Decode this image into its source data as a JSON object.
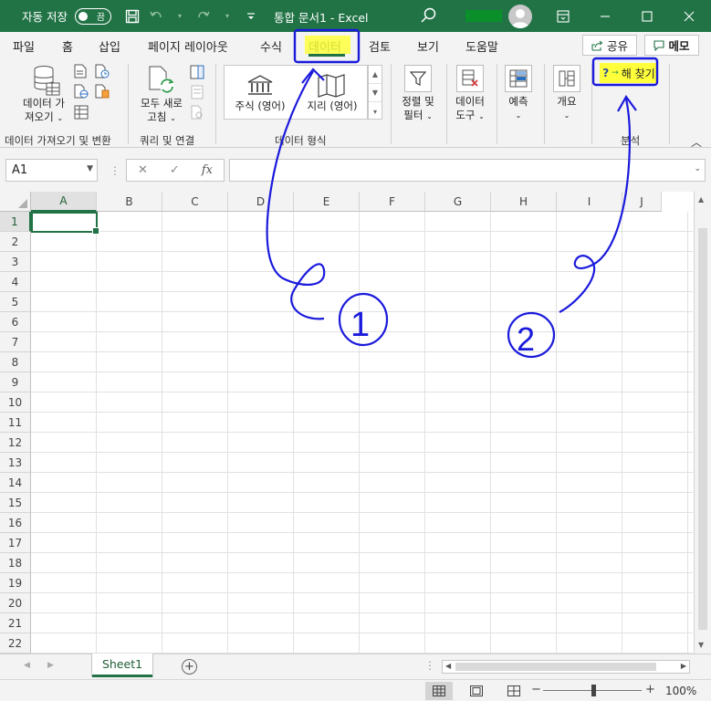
{
  "titlebar": {
    "autosave_label": "자동 저장",
    "autosave_state": "끔",
    "document_title": "통합 문서1  -  Excel"
  },
  "tabs": {
    "file": "파일",
    "home": "홈",
    "insert": "삽입",
    "page_layout": "페이지 레이아웃",
    "formulas": "수식",
    "data": "데이터",
    "review": "검토",
    "view": "보기",
    "help": "도움말"
  },
  "actions": {
    "share": "공유",
    "memo": "메모"
  },
  "ribbon": {
    "get_data_line1": "데이터 가",
    "get_data_line2": "져오기",
    "refresh_line1": "모두 새로",
    "refresh_line2": "고침",
    "stocks": "주식 (영어)",
    "geography": "지리 (영어)",
    "sort_line1": "정렬 및",
    "sort_line2": "필터",
    "data_tools_line1": "데이터",
    "data_tools_line2": "도구",
    "forecast": "예측",
    "outline": "개요",
    "solver": "해 찾기",
    "groups": {
      "get_transform": "데이터 가져오기 및 변환",
      "queries": "쿼리 및 연결",
      "data_types": "데이터 형식",
      "analysis": "분석"
    }
  },
  "formula_bar": {
    "name_box": "A1",
    "fx": "fx",
    "formula": ""
  },
  "grid": {
    "columns": [
      "A",
      "B",
      "C",
      "D",
      "E",
      "F",
      "G",
      "H",
      "I",
      "J"
    ],
    "rows": [
      "1",
      "2",
      "3",
      "4",
      "5",
      "6",
      "7",
      "8",
      "9",
      "10",
      "11",
      "12",
      "13",
      "14",
      "15",
      "16",
      "17",
      "18",
      "19",
      "20",
      "21",
      "22"
    ]
  },
  "sheets": {
    "active": "Sheet1"
  },
  "status": {
    "zoom": "100%"
  },
  "annotations": {
    "step1": "1",
    "step2": "2",
    "ink_color": "#1a1adc",
    "highlight_color": "#ffff3c"
  }
}
